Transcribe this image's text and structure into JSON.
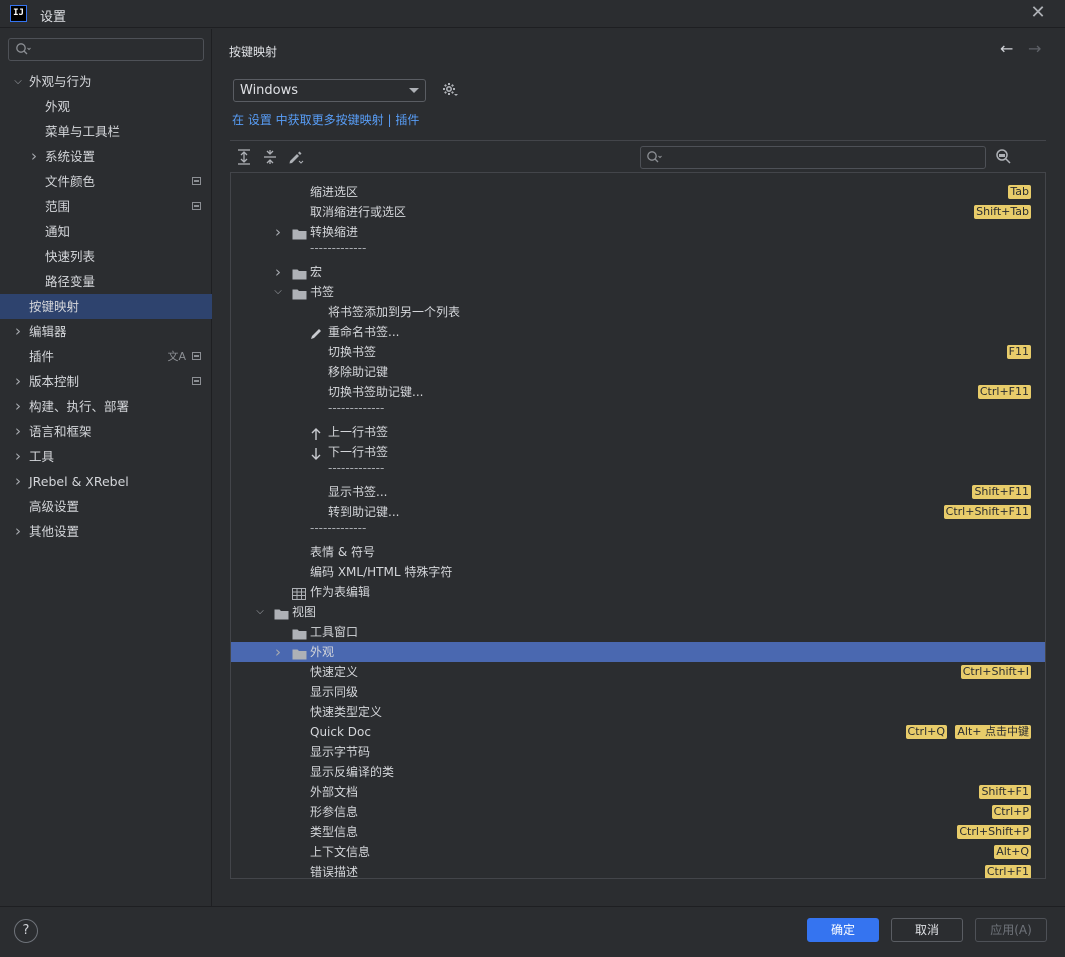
{
  "window": {
    "title": "设置",
    "app_icon_text": "IJ"
  },
  "sidebar": {
    "search_placeholder": "",
    "items": [
      {
        "label": "外观与行为",
        "level": 0,
        "expand": "open"
      },
      {
        "label": "外观",
        "level": 1
      },
      {
        "label": "菜单与工具栏",
        "level": 1
      },
      {
        "label": "系统设置",
        "level": 1,
        "expand": "closed"
      },
      {
        "label": "文件颜色",
        "level": 1,
        "badge": true
      },
      {
        "label": "范围",
        "level": 1,
        "badge": true
      },
      {
        "label": "通知",
        "level": 1
      },
      {
        "label": "快速列表",
        "level": 1
      },
      {
        "label": "路径变量",
        "level": 1
      },
      {
        "label": "按键映射",
        "level": 0,
        "selected": true
      },
      {
        "label": "编辑器",
        "level": 0,
        "expand": "closed"
      },
      {
        "label": "插件",
        "level": 0,
        "badge": true,
        "translate": true
      },
      {
        "label": "版本控制",
        "level": 0,
        "expand": "closed",
        "badge": true
      },
      {
        "label": "构建、执行、部署",
        "level": 0,
        "expand": "closed"
      },
      {
        "label": "语言和框架",
        "level": 0,
        "expand": "closed"
      },
      {
        "label": "工具",
        "level": 0,
        "expand": "closed"
      },
      {
        "label": "JRebel & XRebel",
        "level": 0,
        "expand": "closed"
      },
      {
        "label": "高级设置",
        "level": 0
      },
      {
        "label": "其他设置",
        "level": 0,
        "expand": "closed"
      }
    ]
  },
  "header": {
    "breadcrumb": "按键映射"
  },
  "keymap": {
    "selected": "Windows",
    "link_prefix": "在 设置 中获取更多按键映射 |",
    "link_plugins": "插件"
  },
  "tree": {
    "search_placeholder": "",
    "rows": [
      {
        "type": "sep",
        "indent": 3
      },
      {
        "label": "缩进选区",
        "indent": 3,
        "keys": [
          "Tab"
        ]
      },
      {
        "label": "取消缩进行或选区",
        "indent": 3,
        "keys": [
          "Shift+Tab"
        ]
      },
      {
        "label": "转换缩进",
        "indent": 3,
        "folder": true,
        "expand": "closed"
      },
      {
        "type": "sep",
        "indent": 3
      },
      {
        "label": "宏",
        "indent": 3,
        "folder": true,
        "expand": "closed"
      },
      {
        "label": "书签",
        "indent": 3,
        "folder": true,
        "expand": "open"
      },
      {
        "label": "将书签添加到另一个列表",
        "indent": 4
      },
      {
        "label": "重命名书签...",
        "indent": 4,
        "icon": "pencil"
      },
      {
        "label": "切换书签",
        "indent": 4,
        "keys": [
          "F11"
        ]
      },
      {
        "label": "移除助记键",
        "indent": 4
      },
      {
        "label": "切换书签助记键...",
        "indent": 4,
        "keys": [
          "Ctrl+F11"
        ]
      },
      {
        "type": "sep",
        "indent": 4
      },
      {
        "label": "上一行书签",
        "indent": 4,
        "icon": "up"
      },
      {
        "label": "下一行书签",
        "indent": 4,
        "icon": "down"
      },
      {
        "type": "sep",
        "indent": 4
      },
      {
        "label": "显示书签...",
        "indent": 4,
        "keys": [
          "Shift+F11"
        ]
      },
      {
        "label": "转到助记键...",
        "indent": 4,
        "keys": [
          "Ctrl+Shift+F11"
        ]
      },
      {
        "type": "sep",
        "indent": 3
      },
      {
        "label": "表情 & 符号",
        "indent": 3
      },
      {
        "label": "编码 XML/HTML 特殊字符",
        "indent": 3
      },
      {
        "label": "作为表编辑",
        "indent": 3,
        "icon": "table"
      },
      {
        "label": "视图",
        "indent": 2,
        "folder": true,
        "expand": "open"
      },
      {
        "label": "工具窗口",
        "indent": 3,
        "folder": true
      },
      {
        "label": "外观",
        "indent": 3,
        "folder": true,
        "expand": "closed",
        "selected": true
      },
      {
        "label": "快速定义",
        "indent": 3,
        "keys": [
          "Ctrl+Shift+I"
        ]
      },
      {
        "label": "显示同级",
        "indent": 3
      },
      {
        "label": "快速类型定义",
        "indent": 3
      },
      {
        "label": "Quick Doc",
        "indent": 3,
        "keys": [
          "Ctrl+Q",
          "Alt+ 点击中键"
        ]
      },
      {
        "label": "显示字节码",
        "indent": 3
      },
      {
        "label": "显示反编译的类",
        "indent": 3
      },
      {
        "label": "外部文档",
        "indent": 3,
        "keys": [
          "Shift+F1"
        ]
      },
      {
        "label": "形参信息",
        "indent": 3,
        "keys": [
          "Ctrl+P"
        ]
      },
      {
        "label": "类型信息",
        "indent": 3,
        "keys": [
          "Ctrl+Shift+P"
        ]
      },
      {
        "label": "上下文信息",
        "indent": 3,
        "keys": [
          "Alt+Q"
        ]
      },
      {
        "label": "错误描述",
        "indent": 3,
        "keys": [
          "Ctrl+F1"
        ]
      }
    ],
    "separator_text": "-------------"
  },
  "footer": {
    "help": "?",
    "ok": "确定",
    "cancel": "取消",
    "apply": "应用(A)"
  },
  "colors": {
    "accent": "#3574f0",
    "selection": "#4a68b0",
    "link": "#589df6",
    "shortcut_bg": "#e8cc6a"
  }
}
